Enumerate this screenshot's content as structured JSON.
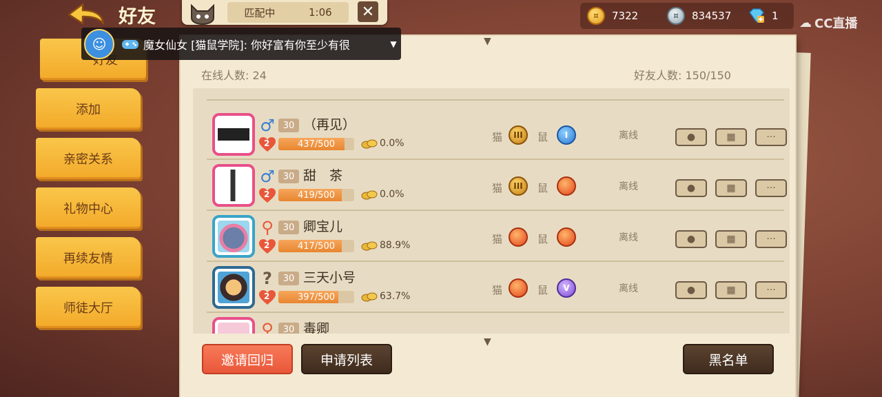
{
  "header": {
    "title": "好友",
    "matching_label": "匹配中",
    "matching_time": "1:06",
    "close_label": "✕"
  },
  "currencies": {
    "gold": "7322",
    "silver": "834537",
    "diamond": "1"
  },
  "watermark": "CC直播",
  "chat_banner": {
    "text": "魔女仙女 [猫鼠学院]: 你好富有你至少有很"
  },
  "nav": {
    "items": [
      "好友",
      "添加",
      "亲密关系",
      "礼物中心",
      "再续友情",
      "师徒大厅"
    ]
  },
  "stats": {
    "online": "在线人数: 24",
    "friends": "好友人数: 150/150"
  },
  "role_labels": {
    "cat": "猫",
    "mouse": "鼠"
  },
  "friends": [
    {
      "name": "（再见）",
      "gender": "♂",
      "level": "30",
      "intimacy": "2",
      "exp": "437/500",
      "exp_fraction": 0.874,
      "winrate": "0.0%",
      "cat_rank": "III",
      "mouse_rank": "I",
      "status": "离线"
    },
    {
      "name": "甜　茶",
      "gender": "♂",
      "level": "30",
      "intimacy": "2",
      "exp": "419/500",
      "exp_fraction": 0.838,
      "winrate": "0.0%",
      "cat_rank": "III",
      "mouse_rank": "",
      "status": "离线"
    },
    {
      "name": "卿宝儿",
      "gender": "",
      "level": "30",
      "intimacy": "2",
      "exp": "417/500",
      "exp_fraction": 0.834,
      "winrate": "88.9%",
      "cat_rank": "",
      "mouse_rank": "",
      "status": "离线"
    },
    {
      "name": "三天小号",
      "gender": "?",
      "level": "30",
      "intimacy": "2",
      "exp": "397/500",
      "exp_fraction": 0.794,
      "winrate": "63.7%",
      "cat_rank": "",
      "mouse_rank": "V",
      "status": "离线"
    },
    {
      "name": "毒卿",
      "gender": "",
      "level": "30",
      "intimacy": "",
      "exp": "",
      "exp_fraction": 0,
      "winrate": "",
      "cat_rank": "",
      "mouse_rank": "",
      "status": ""
    }
  ],
  "buttons": {
    "invite_back": "邀请回归",
    "request_list": "申请列表",
    "blacklist": "黑名单"
  },
  "action_icons": [
    "chat-icon",
    "gift-icon",
    "more-icon"
  ],
  "colors": {
    "tab_yellow": "#f7b83a",
    "paper": "#f4ead4",
    "accent_red": "#ee6446",
    "dark_button": "#4a3424"
  }
}
